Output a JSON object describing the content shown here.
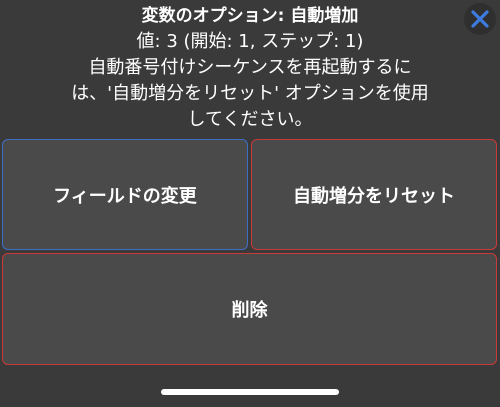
{
  "dialog": {
    "title": "変数のオプション: 自動増加",
    "message_lines": [
      "値: 3 (開始: 1, ステップ: 1)",
      "自動番号付けシーケンスを再起動するに",
      "は、'自動増分をリセット' オプションを使用",
      "してください。"
    ],
    "close_icon": "close-x-icon"
  },
  "buttons": {
    "change_field": "フィールドの変更",
    "reset_increment": "自動増分をリセット",
    "delete": "削除"
  },
  "colors": {
    "background": "#3a3a3a",
    "button": "#4a4a4a",
    "accent_blue": "#3f6fc4",
    "accent_red": "#c93a3a",
    "close_icon": "#3d7be0"
  }
}
